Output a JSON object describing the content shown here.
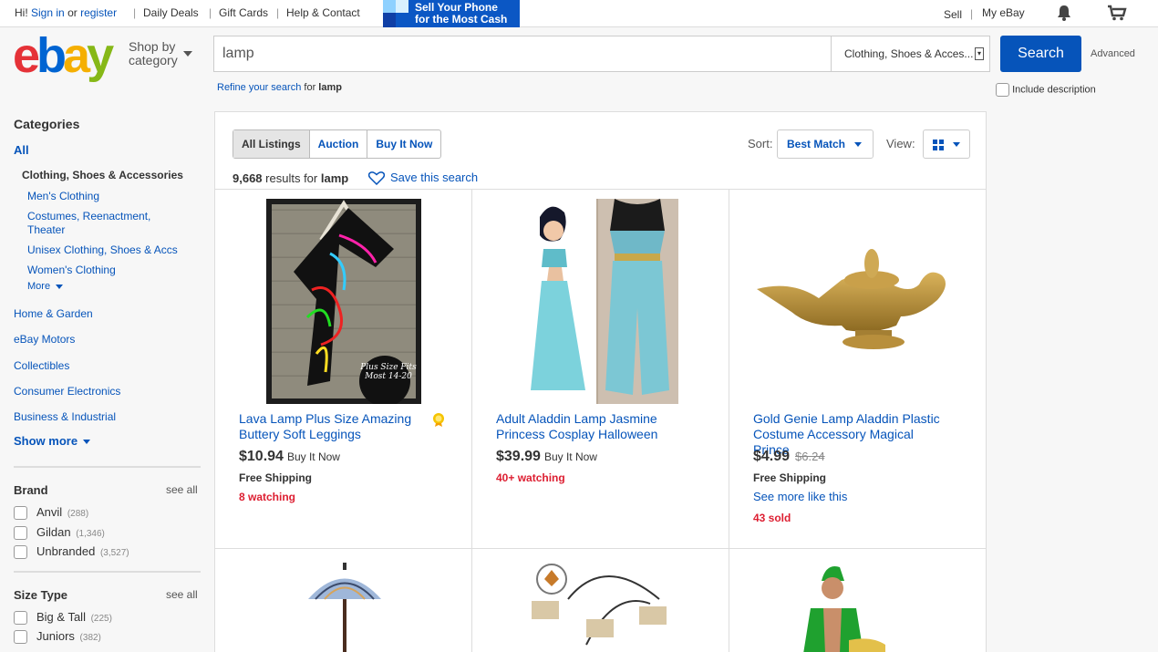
{
  "topbar": {
    "greeting": "Hi!",
    "sign_in": "Sign in",
    "or": "or",
    "register": "register",
    "links": [
      "Daily Deals",
      "Gift Cards",
      "Help & Contact"
    ],
    "promo_line1": "Sell Your Phone",
    "promo_line2": "for the Most Cash",
    "sell": "Sell",
    "my_ebay": "My eBay"
  },
  "header": {
    "shop_by_line1": "Shop by",
    "shop_by_line2": "category",
    "search_value": "lamp",
    "category_select": "Clothing, Shoes & Acces...",
    "search_button": "Search",
    "advanced": "Advanced",
    "refine_link": "Refine your search",
    "refine_for": "for",
    "refine_term": "lamp",
    "include_description": "Include description"
  },
  "sidebar": {
    "categories_title": "Categories",
    "all": "All",
    "current": "Clothing, Shoes & Accessories",
    "subcategories": [
      "Men's Clothing",
      "Costumes, Reenactment,",
      "Theater",
      "Unisex Clothing, Shoes & Accs",
      "Women's Clothing"
    ],
    "more": "More",
    "top_categories": [
      "Home & Garden",
      "eBay Motors",
      "Collectibles",
      "Consumer Electronics",
      "Business & Industrial"
    ],
    "show_more": "Show more",
    "brand": {
      "title": "Brand",
      "see_all": "see all",
      "options": [
        {
          "label": "Anvil",
          "count": "(288)"
        },
        {
          "label": "Gildan",
          "count": "(1,346)"
        },
        {
          "label": "Unbranded",
          "count": "(3,527)"
        }
      ]
    },
    "size_type": {
      "title": "Size Type",
      "see_all": "see all",
      "options": [
        {
          "label": "Big & Tall",
          "count": "(225)"
        },
        {
          "label": "Juniors",
          "count": "(382)"
        }
      ]
    }
  },
  "results": {
    "tabs": [
      "All Listings",
      "Auction",
      "Buy It Now"
    ],
    "sort_label": "Sort:",
    "sort_value": "Best Match",
    "view_label": "View:",
    "count": "9,668",
    "results_for": "results for",
    "query": "lamp",
    "save_search": "Save this search",
    "items": [
      {
        "title": "Lava Lamp Plus Size Amazing Buttery Soft Leggings",
        "price": "$10.94",
        "format": "Buy It Now",
        "old_price": "",
        "shipping": "Free Shipping",
        "more": "",
        "status": "8 watching",
        "image_text": "Plus Size Fits Most 14-20"
      },
      {
        "title": "Adult Aladdin Lamp Jasmine Princess Cosplay Halloween",
        "price": "$39.99",
        "format": "Buy It Now",
        "old_price": "",
        "shipping": "",
        "more": "",
        "status": "40+ watching",
        "image_text": ""
      },
      {
        "title": "Gold Genie Lamp Aladdin Plastic Costume Accessory Magical Prince",
        "price": "$4.99",
        "format": "",
        "old_price": "$6.24",
        "shipping": "Free Shipping",
        "more": "See more like this",
        "status": "43 sold",
        "image_text": ""
      }
    ]
  },
  "colors": {
    "link": "#0654ba",
    "search_button": "#0654ba",
    "alert": "#dd1e31",
    "ebay_e": "#e53238",
    "ebay_b": "#0064d2",
    "ebay_a": "#f5af02",
    "ebay_y": "#86b817"
  }
}
